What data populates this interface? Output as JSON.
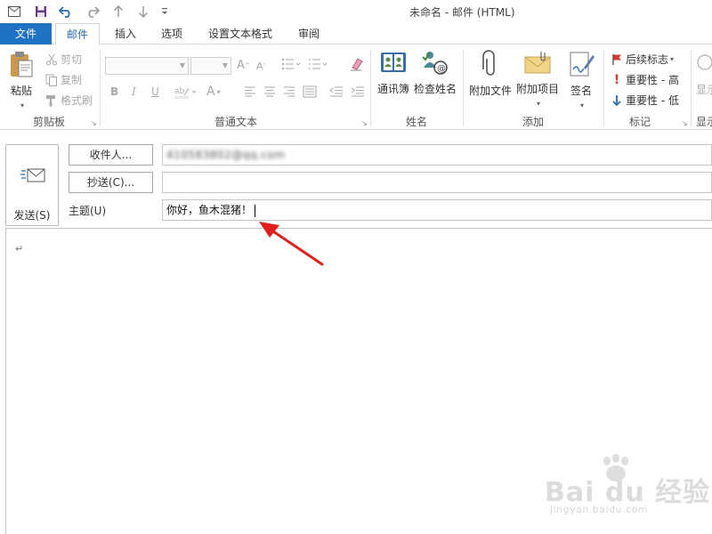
{
  "window": {
    "title": "未命名 - 邮件 (HTML)"
  },
  "tabs": [
    {
      "label": "文件"
    },
    {
      "label": "邮件"
    },
    {
      "label": "插入"
    },
    {
      "label": "选项"
    },
    {
      "label": "设置文本格式"
    },
    {
      "label": "审阅"
    }
  ],
  "ribbon": {
    "clipboard": {
      "group": "剪贴板",
      "paste": "粘贴",
      "cut": "剪切",
      "copy": "复制",
      "format_painter": "格式刷"
    },
    "basic_text": {
      "group": "普通文本",
      "bold": "B",
      "italic": "I",
      "underline": "U"
    },
    "names": {
      "group": "姓名",
      "address_book": "通讯簿",
      "check_names": "检查姓名"
    },
    "include": {
      "group": "添加",
      "attach_file": "附加文件",
      "attach_item": "附加项目",
      "signature": "签名"
    },
    "tags": {
      "group": "标记",
      "follow_up": "后续标志",
      "high_importance": "重要性 - 高",
      "low_importance": "重要性 - 低"
    },
    "partial": {
      "show": "显示",
      "group_partial": "显示"
    }
  },
  "compose": {
    "send": "发送(S)",
    "to_button": "收件人...",
    "to_value": "410583802@qq.com",
    "cc_button": "抄送(C)...",
    "cc_value": "",
    "subject_label": "主题(U)",
    "subject_value": "你好，鱼木混猪！"
  },
  "body": {
    "paragraph_mark": "↵"
  },
  "watermark": {
    "main": "Bai du 经验",
    "sub": "jingyan.baidu.com"
  },
  "colors": {
    "accent": "#2072c4",
    "arrow": "#e0201c"
  }
}
